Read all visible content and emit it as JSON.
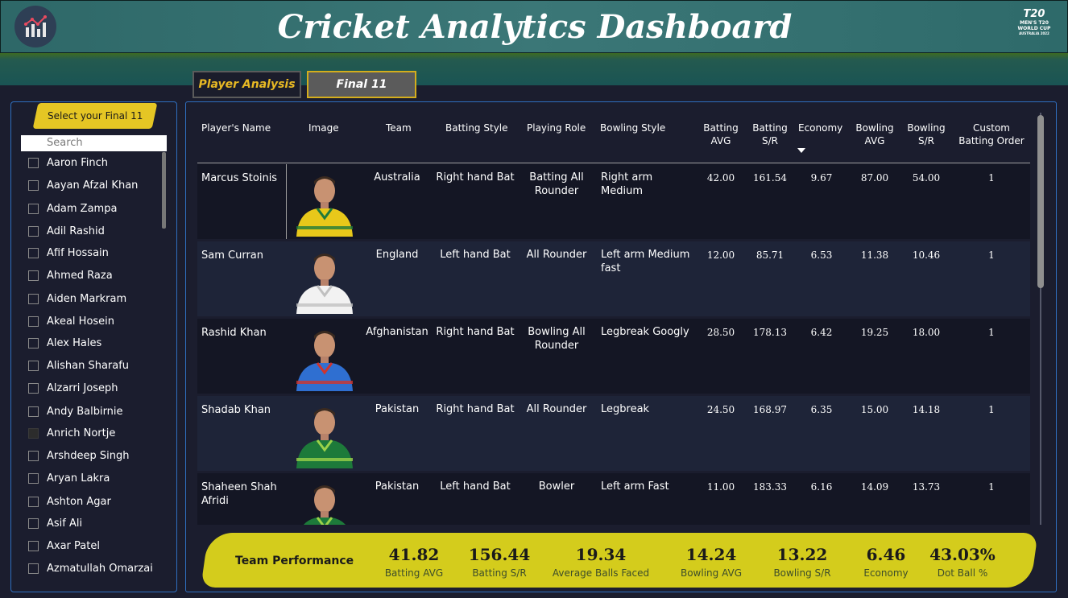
{
  "header": {
    "title": "Cricket Analytics Dashboard",
    "logo_icon": "analytics-chart-icon",
    "event_logo": {
      "line1": "T20",
      "line2": "MEN'S T20",
      "line3": "WORLD CUP",
      "line4": "AUSTRALIA 2022"
    }
  },
  "tabs": [
    {
      "label": "Player Analysis",
      "active": false
    },
    {
      "label": "Final 11",
      "active": true
    }
  ],
  "slicer": {
    "title": "Select your Final 11",
    "search_placeholder": "Search",
    "items": [
      "Aaron Finch",
      "Aayan Afzal Khan",
      "Adam Zampa",
      "Adil Rashid",
      "Afif Hossain",
      "Ahmed Raza",
      "Aiden Markram",
      "Akeal Hosein",
      "Alex Hales",
      "Alishan Sharafu",
      "Alzarri Joseph",
      "Andy Balbirnie",
      "Anrich Nortje",
      "Arshdeep Singh",
      "Aryan Lakra",
      "Ashton Agar",
      "Asif Ali",
      "Axar Patel",
      "Azmatullah Omarzai"
    ]
  },
  "table": {
    "columns": [
      "Player's Name",
      "Image",
      "Team",
      "Batting Style",
      "Playing Role",
      "Bowling Style",
      "Batting AVG",
      "Batting S/R",
      "Economy",
      "Bowling AVG",
      "Bowling S/R",
      "Custom Batting Order"
    ],
    "sorted_column": "Economy",
    "rows": [
      {
        "name": "Marcus Stoinis",
        "team": "Australia",
        "batting_style": "Right hand Bat",
        "role": "Batting All Rounder",
        "bowling_style": "Right arm Medium",
        "bat_avg": "42.00",
        "bat_sr": "161.54",
        "economy": "9.67",
        "bowl_avg": "87.00",
        "bowl_sr": "54.00",
        "order": "1",
        "kit": "#e8c81a",
        "kit2": "#1f7a3a"
      },
      {
        "name": "Sam Curran",
        "team": "England",
        "batting_style": "Left hand Bat",
        "role": "All Rounder",
        "bowling_style": "Left arm Medium fast",
        "bat_avg": "12.00",
        "bat_sr": "85.71",
        "economy": "6.53",
        "bowl_avg": "11.38",
        "bowl_sr": "10.46",
        "order": "1",
        "kit": "#f2f2f2",
        "kit2": "#c0c0c0"
      },
      {
        "name": "Rashid Khan",
        "team": "Afghanistan",
        "batting_style": "Right hand Bat",
        "role": "Bowling All Rounder",
        "bowling_style": "Legbreak Googly",
        "bat_avg": "28.50",
        "bat_sr": "178.13",
        "economy": "6.42",
        "bowl_avg": "19.25",
        "bowl_sr": "18.00",
        "order": "1",
        "kit": "#2f6fd1",
        "kit2": "#d0342c"
      },
      {
        "name": "Shadab Khan",
        "team": "Pakistan",
        "batting_style": "Right hand Bat",
        "role": "All Rounder",
        "bowling_style": "Legbreak",
        "bat_avg": "24.50",
        "bat_sr": "168.97",
        "economy": "6.35",
        "bowl_avg": "15.00",
        "bowl_sr": "14.18",
        "order": "1",
        "kit": "#1d7a3a",
        "kit2": "#9bd24a"
      },
      {
        "name": "Shaheen Shah Afridi",
        "team": "Pakistan",
        "batting_style": "Left hand Bat",
        "role": "Bowler",
        "bowling_style": "Left arm Fast",
        "bat_avg": "11.00",
        "bat_sr": "183.33",
        "economy": "6.16",
        "bowl_avg": "14.09",
        "bowl_sr": "13.73",
        "order": "1",
        "kit": "#1d7a3a",
        "kit2": "#9bd24a"
      }
    ]
  },
  "kpis": {
    "label": "Team Performance",
    "items": [
      {
        "value": "41.82",
        "label": "Batting AVG"
      },
      {
        "value": "156.44",
        "label": "Batting S/R"
      },
      {
        "value": "19.34",
        "label": "Average Balls Faced"
      },
      {
        "value": "14.24",
        "label": "Bowling AVG"
      },
      {
        "value": "13.22",
        "label": "Bowling S/R"
      },
      {
        "value": "6.46",
        "label": "Economy"
      },
      {
        "value": "43.03%",
        "label": "Dot Ball %"
      }
    ]
  }
}
